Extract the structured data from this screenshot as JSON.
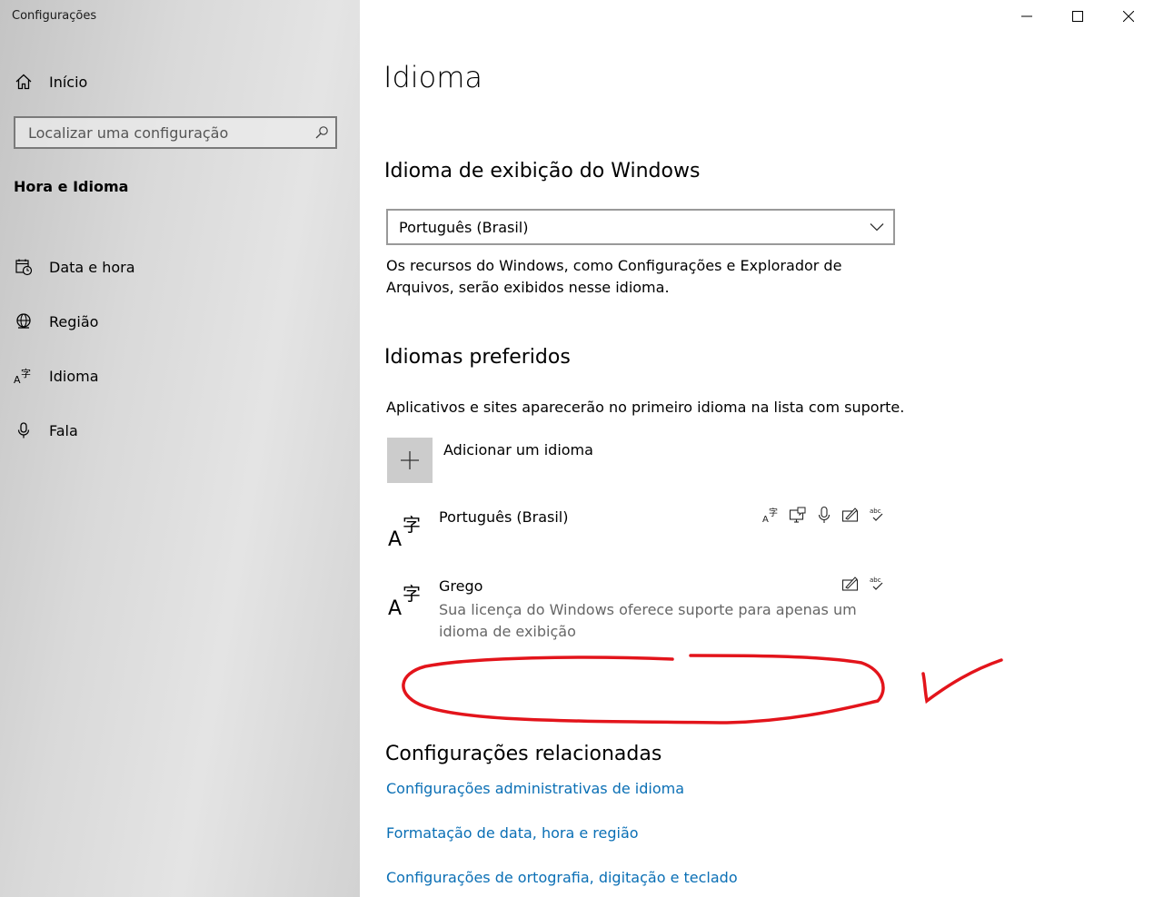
{
  "app": {
    "title": "Configurações"
  },
  "sidebar": {
    "home_label": "Início",
    "search_placeholder": "Localizar uma configuração",
    "section_heading": "Hora e Idioma",
    "items": [
      {
        "label": "Data e hora",
        "icon": "calendar-clock-icon"
      },
      {
        "label": "Região",
        "icon": "globe-icon"
      },
      {
        "label": "Idioma",
        "icon": "language-icon"
      },
      {
        "label": "Fala",
        "icon": "microphone-icon"
      }
    ]
  },
  "page": {
    "title": "Idioma",
    "display_language": {
      "heading": "Idioma de exibição do Windows",
      "selected": "Português (Brasil)",
      "description": "Os recursos do Windows, como Configurações e Explorador de Arquivos, serão exibidos nesse idioma."
    },
    "preferred": {
      "heading": "Idiomas preferidos",
      "description": "Aplicativos e sites aparecerão no primeiro idioma na lista com suporte.",
      "add_label": "Adicionar um idioma",
      "languages": [
        {
          "name": "Português (Brasil)",
          "note": "",
          "features": [
            "display-language-icon",
            "text-to-speech-icon",
            "speech-recognition-icon",
            "handwriting-icon",
            "spellcheck-icon"
          ]
        },
        {
          "name": "Grego",
          "note": "Sua licença do Windows oferece suporte para apenas um idioma de exibição",
          "features": [
            "handwriting-icon",
            "spellcheck-icon"
          ]
        }
      ]
    },
    "related": {
      "heading": "Configurações relacionadas",
      "links": [
        "Configurações administrativas de idioma",
        "Formatação de data, hora e região",
        "Configurações de ortografia, digitação e teclado"
      ]
    }
  },
  "colors": {
    "accent_link": "#0a6fb5",
    "annotation": "#e3141b"
  }
}
